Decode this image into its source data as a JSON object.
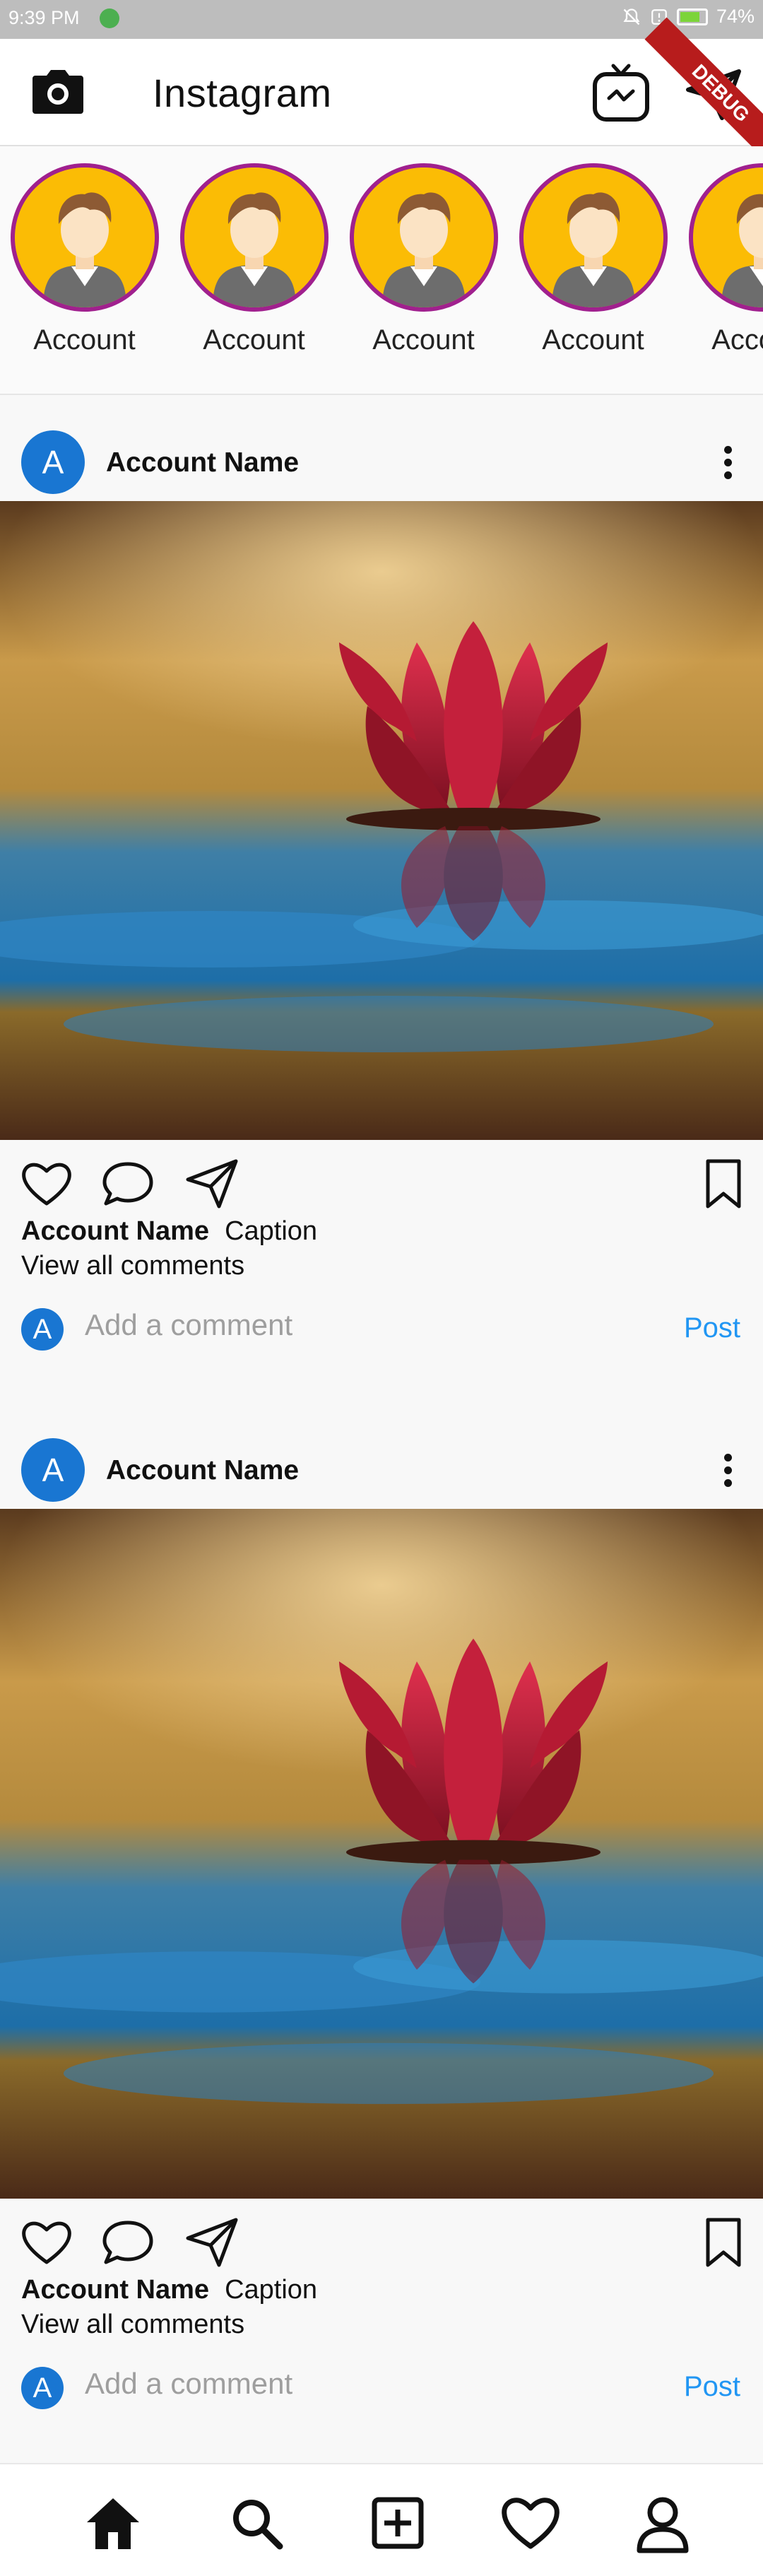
{
  "status_bar": {
    "time": "9:39 PM",
    "battery": "74%"
  },
  "app_bar": {
    "title": "Instagram",
    "debug_banner": "DEBUG"
  },
  "stories": [
    {
      "label": "Account"
    },
    {
      "label": "Account"
    },
    {
      "label": "Account"
    },
    {
      "label": "Account"
    },
    {
      "label": "Account"
    }
  ],
  "posts": [
    {
      "avatar_letter": "A",
      "account_name": "Account Name",
      "caption_account": "Account Name",
      "caption": "Caption",
      "view_comments": "View all comments",
      "comment_avatar_letter": "A",
      "comment_placeholder": "Add a comment",
      "post_label": "Post"
    },
    {
      "avatar_letter": "A",
      "account_name": "Account Name",
      "caption_account": "Account Name",
      "caption": "Caption",
      "view_comments": "View all comments",
      "comment_avatar_letter": "A",
      "comment_placeholder": "Add a comment",
      "post_label": "Post"
    }
  ],
  "bottom_nav": [
    {
      "icon": "home-icon"
    },
    {
      "icon": "search-icon"
    },
    {
      "icon": "add-post-icon"
    },
    {
      "icon": "heart-icon"
    },
    {
      "icon": "profile-icon"
    }
  ],
  "colors": {
    "accent": "#2196f3",
    "story_ring": "#a0208e",
    "avatar_bg": "#1976d2"
  }
}
